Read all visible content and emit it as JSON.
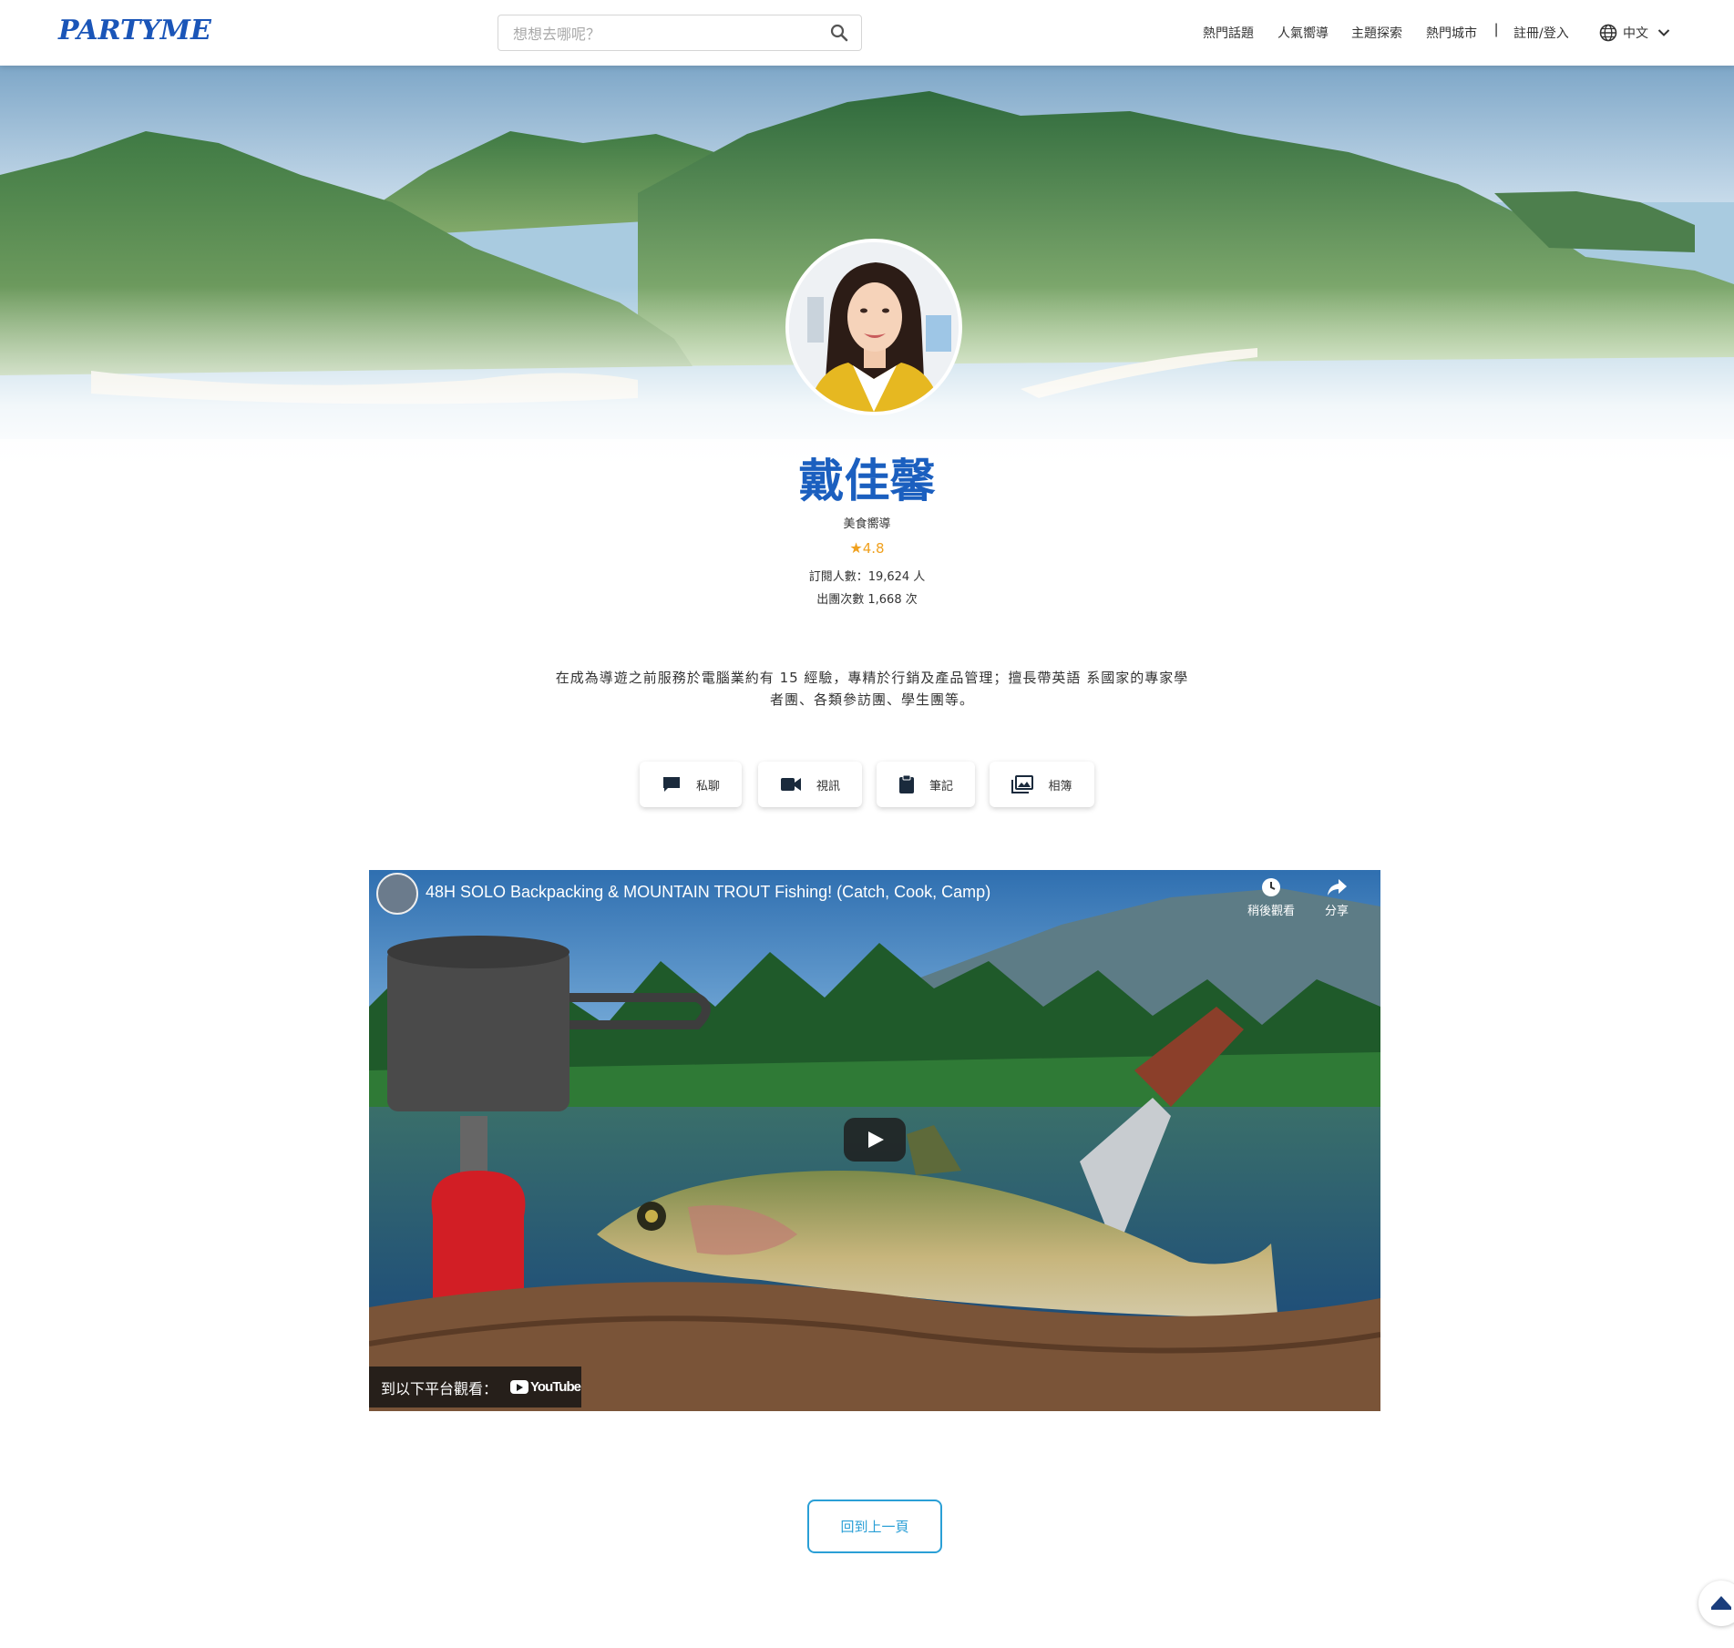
{
  "header": {
    "logo": "PARTYME",
    "search_placeholder": "想想去哪呢？",
    "nav": [
      "熱門話題",
      "人氣嚮導",
      "主題探索",
      "熱門城市"
    ],
    "separator": "|",
    "login": "註冊/登入",
    "language": "中文"
  },
  "profile": {
    "name": "戴佳馨",
    "role": "美食嚮導",
    "rating": "4.8",
    "subscribers": "訂閱人數：19,624 人",
    "tours": "出團次數 1,668 次",
    "bio": "在成為導遊之前服務於電腦業約有 15 經驗，專精於行銷及產品管理；擅長帶英語 系國家的專家學者團、各類參訪團、學生團等。"
  },
  "actions": [
    "私聊",
    "視訊",
    "筆記",
    "相簿"
  ],
  "video": {
    "title": "48H SOLO Backpacking & MOUNTAIN TROUT Fishing! (Catch, Cook, Camp)",
    "watch_later": "稍後觀看",
    "share": "分享",
    "watch_on": "到以下平台觀看：",
    "platform": "YouTube"
  },
  "back_button": "回到上一頁",
  "colors": {
    "brand_blue": "#1b5fbf",
    "rating_orange": "#f0a11f",
    "back_button_blue": "#2a9fd6"
  }
}
